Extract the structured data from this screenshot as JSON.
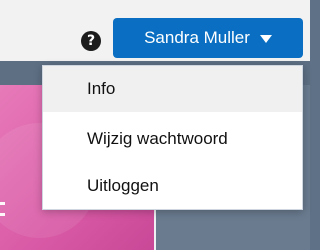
{
  "header": {
    "help_icon": "question-circle-icon",
    "help_glyph": "?",
    "user_name": "Sandra Muller",
    "user_menu_icon": "caret-down-icon"
  },
  "dropdown": {
    "items": [
      {
        "label": "Info",
        "active": true
      },
      {
        "label": "Wijzig wachtwoord",
        "active": false
      },
      {
        "label": "Uitloggen",
        "active": false
      }
    ]
  },
  "colors": {
    "accent": "#0a6fc2",
    "header_background": "#f2f2f2",
    "page_background": "#5e6f84",
    "card_pink": "#d95aa6",
    "menu_hover": "#f0f0f0"
  }
}
